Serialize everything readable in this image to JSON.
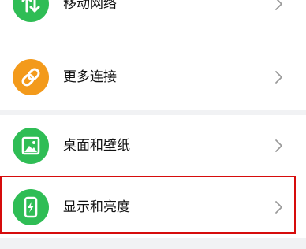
{
  "settings": {
    "items": [
      {
        "label": "移动网络",
        "icon": "mobile-network-icon",
        "color": "#2fbd55"
      },
      {
        "label": "更多连接",
        "icon": "link-icon",
        "color": "#f39a1b"
      },
      {
        "label": "桌面和壁纸",
        "icon": "wallpaper-icon",
        "color": "#2fbd55"
      },
      {
        "label": "显示和亮度",
        "icon": "display-brightness-icon",
        "color": "#2fbd55"
      }
    ]
  },
  "highlight": {
    "color": "#d60c0c",
    "target": "显示和亮度"
  }
}
